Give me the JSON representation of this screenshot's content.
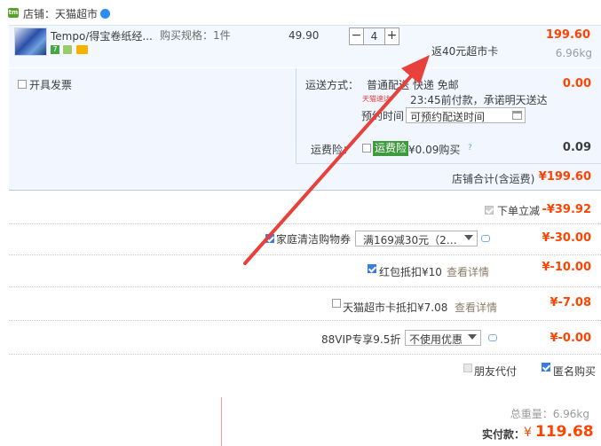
{
  "shop": {
    "label": "店铺：天猫超市"
  },
  "item": {
    "title": "Tempo/得宝卷纸经...",
    "spec": "购买规格：1件",
    "unit_price": "49.90",
    "quantity": "4",
    "decrement": "−",
    "increment": "+",
    "rebate": "返40元超市卡",
    "total": "199.60",
    "weight": "6.96kg",
    "badge_seven": "7"
  },
  "invoice": {
    "label": "开具发票"
  },
  "shipping": {
    "label": "运送方式：",
    "method": "普通配送 快递 免邮",
    "tmall_icon": "天猫速达",
    "promise": "23:45前付款，承诺明天送达",
    "appointment_label": "预约时间",
    "appointment_placeholder": "可预约配送时间",
    "fee": "0.00"
  },
  "insurance": {
    "label": "运费险：",
    "tag": "运费险",
    "price": "¥0.09购买",
    "help": "?",
    "total": "0.09"
  },
  "shop_total": {
    "label": "店铺合计(含运费)",
    "value": "¥199.60"
  },
  "discounts": [
    {
      "label": "下单立减",
      "value": "-¥39.92"
    },
    {
      "label": "家庭清洁购物券",
      "select": "满169减30元（2…",
      "value": "¥-30.00"
    },
    {
      "label": "红包抵扣¥10",
      "link": "查看详情",
      "value": "¥-10.00"
    },
    {
      "label": "天猫超市卡抵扣¥7.08",
      "link": "查看详情",
      "value": "¥-7.08"
    },
    {
      "label": "88VIP专享9.5折",
      "select": "不使用优惠",
      "value": "¥-0.00"
    }
  ],
  "options": {
    "friend_pay": "朋友代付",
    "anonymous": "匿名购买"
  },
  "summary": {
    "weight": "总重量：6.96kg",
    "pay_label": "实付款：",
    "currency": "¥",
    "amount": "119.68"
  },
  "colors": {
    "accent": "#ff4400",
    "link": "#8a7d6a",
    "panel": "#f2f7ff",
    "annotation": "#e8403a"
  }
}
